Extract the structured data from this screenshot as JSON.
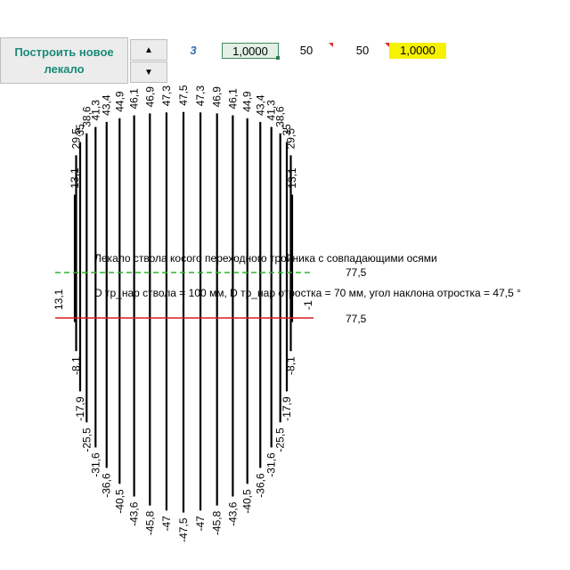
{
  "toolbar": {
    "build_button_label": "Построить новое лекало",
    "spin_up_icon": "triangle-up-icon",
    "spin_down_icon": "triangle-down-icon"
  },
  "cells": {
    "number": "3",
    "value_a": "1,0000",
    "value_b": "50",
    "value_c": "50",
    "value_d": "1,0000"
  },
  "drawing": {
    "caption_title": "Лекало ствола косого переходного тройника с совпадающими осями",
    "caption_params": "D тр_нар ствола = 100 мм, D тр_нар отростка = 70 мм, угол наклона отростка = 47,5 °",
    "green_line_label": "77,5",
    "red_line_label": "77,5",
    "top_labels": [
      "13,1",
      "29,5",
      "35",
      "38,6",
      "41,3",
      "43,4",
      "44,9",
      "46,1",
      "46,9",
      "47,3",
      "47,5",
      "47,3",
      "46,9",
      "46,1",
      "44,9",
      "43,4",
      "41,3",
      "38,6",
      "35",
      "29,5",
      "13,1"
    ],
    "mid_labels_left": "13,1",
    "mid_labels_right": "-1",
    "bottom_labels": [
      "-8,1",
      "-17,9",
      "-25,5",
      "-31,6",
      "-36,6",
      "-40,5",
      "-43,6",
      "-45,8",
      "-47",
      "-47,5",
      "-47",
      "-45,8",
      "-43,6",
      "-40,5",
      "-36,6",
      "-31,6",
      "-25,5",
      "-17,9",
      "-8,1"
    ],
    "colors": {
      "green_line": "#2bb52b",
      "red_line": "#d81e1e",
      "accent": "#1a8a78"
    }
  }
}
